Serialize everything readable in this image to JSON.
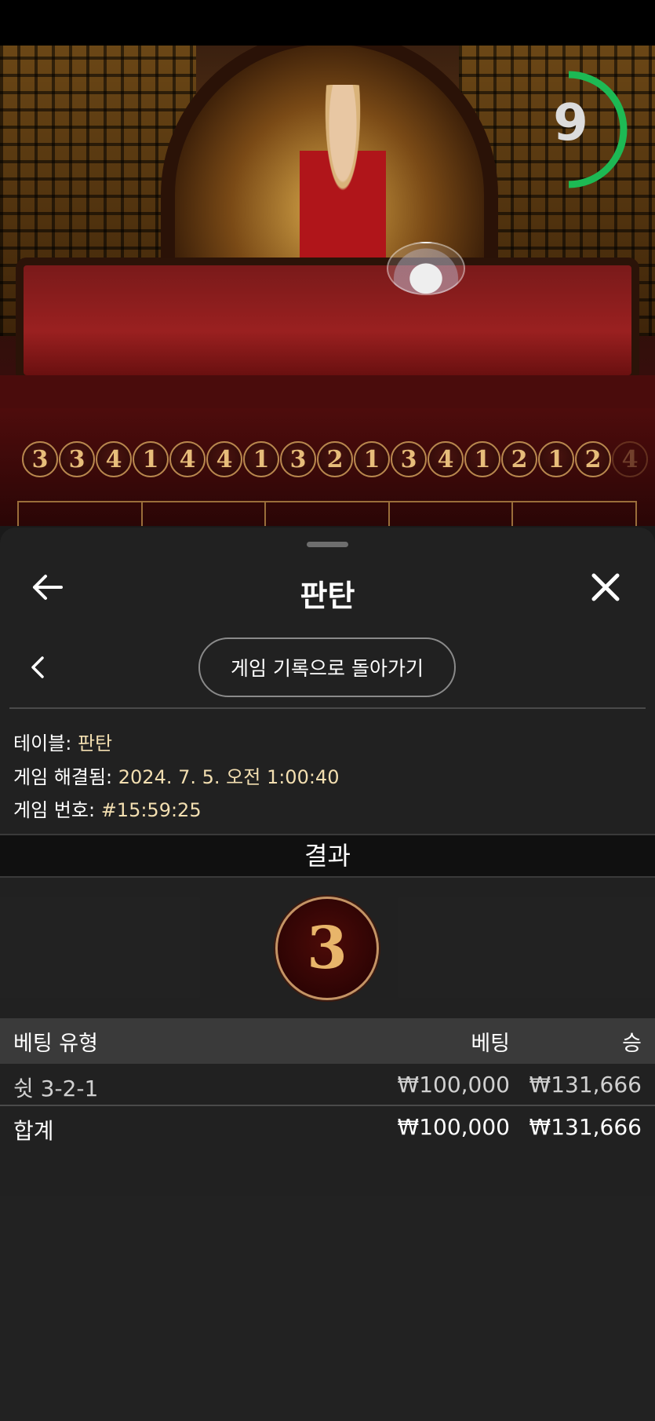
{
  "game": {
    "timer_value": "9",
    "timer_color": "#1db954",
    "history": [
      "3",
      "3",
      "4",
      "1",
      "4",
      "4",
      "1",
      "3",
      "2",
      "1",
      "3",
      "4",
      "1",
      "2",
      "1",
      "2",
      "4"
    ]
  },
  "panel": {
    "title": "판탄",
    "return_label": "게임 기록으로 돌아가기",
    "info": {
      "table_label": "테이블:",
      "table_value": "판탄",
      "resolved_label": "게임 해결됨:",
      "resolved_value": "2024. 7. 5. 오전 1:00:40",
      "number_label": "게임 번호:",
      "number_value": "#15:59:25"
    },
    "result_label": "결과",
    "result_value": "3",
    "bets": {
      "headers": {
        "type": "베팅 유형",
        "bet": "베팅",
        "win": "승"
      },
      "rows": [
        {
          "type": "쉿 3-2-1",
          "bet": "₩100,000",
          "win": "₩131,666"
        }
      ],
      "total": {
        "type": "합계",
        "bet": "₩100,000",
        "win": "₩131,666"
      }
    }
  },
  "icons": {
    "back": "arrow-left-icon",
    "close": "close-icon",
    "prev": "chevron-left-icon"
  }
}
